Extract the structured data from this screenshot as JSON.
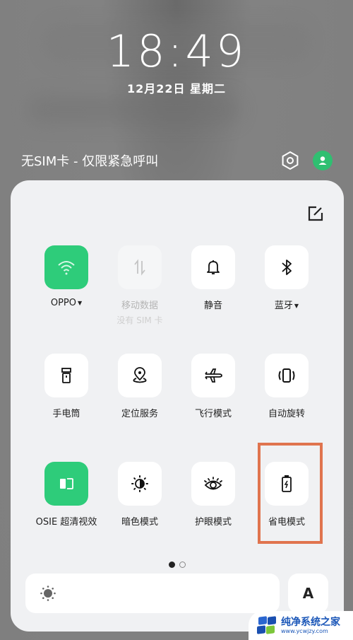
{
  "lockscreen": {
    "time": "18:49",
    "date": "12月22日  星期二",
    "status_text": "无SIM卡 - 仅限紧急呼叫",
    "icons": {
      "settings": "settings-hexagon-icon",
      "user": "user-avatar-icon"
    }
  },
  "panel": {
    "edit_icon": "edit-icon",
    "tiles": [
      {
        "label": "OPPO",
        "icon": "wifi-icon",
        "state": "on",
        "has_caret": true
      },
      {
        "label": "移动数据",
        "sub": "没有 SIM 卡",
        "icon": "mobile-data-icon",
        "state": "disabled"
      },
      {
        "label": "静音",
        "icon": "bell-icon",
        "state": "off"
      },
      {
        "label": "蓝牙",
        "icon": "bluetooth-icon",
        "state": "off",
        "has_caret": true
      },
      {
        "label": "手电筒",
        "icon": "flashlight-icon",
        "state": "off"
      },
      {
        "label": "定位服务",
        "icon": "location-icon",
        "state": "off"
      },
      {
        "label": "飞行模式",
        "icon": "airplane-icon",
        "state": "off"
      },
      {
        "label": "自动旋转",
        "icon": "auto-rotate-icon",
        "state": "off"
      },
      {
        "label": "OSIE 超清视效",
        "icon": "osie-icon",
        "state": "on"
      },
      {
        "label": "暗色模式",
        "icon": "dark-mode-icon",
        "state": "off"
      },
      {
        "label": "护眼模式",
        "icon": "eye-comfort-icon",
        "state": "off"
      },
      {
        "label": "省电模式",
        "icon": "battery-saver-icon",
        "state": "off",
        "highlighted": true
      }
    ],
    "page_indicator": {
      "current": 1,
      "total": 2
    },
    "brightness": {
      "icon": "brightness-sun-icon",
      "level": 0.0
    },
    "auto_brightness_label": "A"
  },
  "colors": {
    "accent_green": "#2ecc7a",
    "highlight_orange": "#e0744e"
  },
  "watermark": {
    "title": "纯净系统之家",
    "url": "www.ycwjzy.com"
  }
}
